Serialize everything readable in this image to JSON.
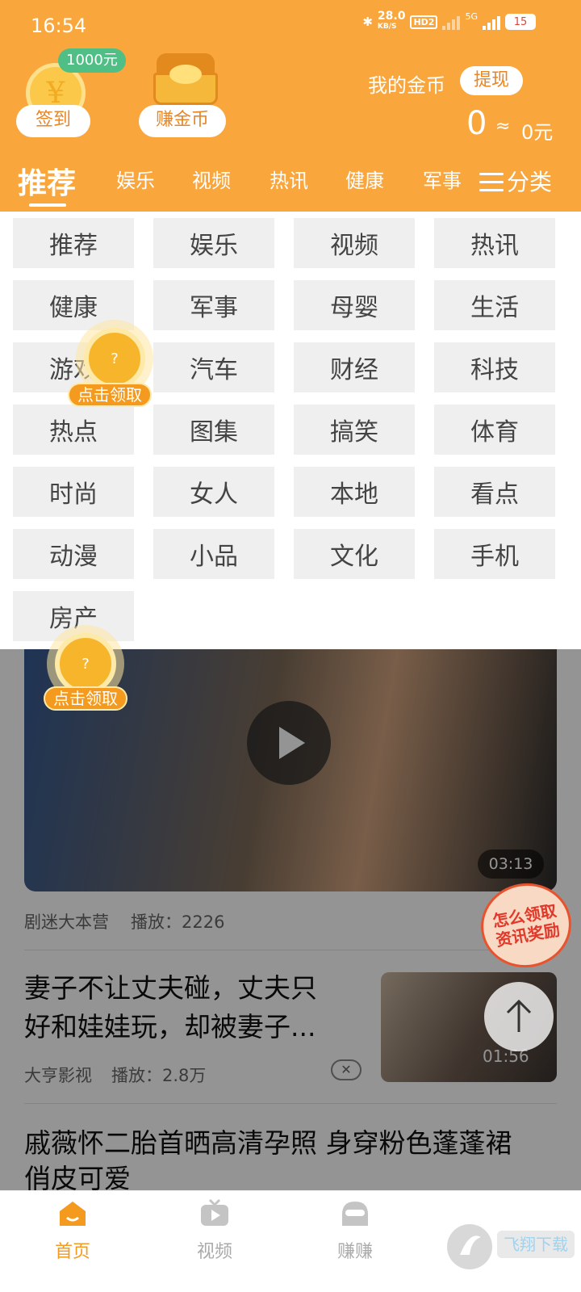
{
  "status_bar": {
    "time": "16:54",
    "network_speed": "28.0",
    "network_unit": "KB/S",
    "hd_badge": "HD2",
    "signal_label": "5G",
    "battery": "15"
  },
  "header": {
    "checkin_badge": "1000元",
    "checkin_label": "签到",
    "earn_coins_label": "赚金币",
    "my_coins_label": "我的金币",
    "withdraw_label": "提现",
    "coin_count": "0",
    "approx": "≈",
    "coin_value": "0元"
  },
  "tabs": [
    {
      "label": "推荐"
    },
    {
      "label": "娱乐"
    },
    {
      "label": "视频"
    },
    {
      "label": "热讯"
    },
    {
      "label": "健康"
    },
    {
      "label": "军事"
    }
  ],
  "category_label": "分类",
  "categories": [
    "推荐",
    "娱乐",
    "视频",
    "热讯",
    "健康",
    "军事",
    "母婴",
    "生活",
    "游戏",
    "汽车",
    "财经",
    "科技",
    "热点",
    "图集",
    "搞笑",
    "体育",
    "时尚",
    "女人",
    "本地",
    "看点",
    "动漫",
    "小品",
    "文化",
    "手机",
    "房产"
  ],
  "floating_coins": [
    {
      "symbol": "?",
      "label": "点击领取"
    },
    {
      "symbol": "?",
      "label": "点击领取"
    }
  ],
  "feed": {
    "video1": {
      "duration": "03:13",
      "source": "剧迷大本营",
      "plays": "播放：2226"
    },
    "article1": {
      "title_line1": "妻子不让丈夫碰，丈夫只",
      "title_line2": "好和娃娃玩，却被妻子...",
      "source": "大亨影视",
      "plays": "播放：2.8万",
      "duration": "01:56"
    },
    "article2": {
      "title_line1": "戚薇怀二胎首晒高清孕照 身穿粉色蓬蓬裙",
      "title_line2": "俏皮可爱"
    },
    "reward_badge_line1": "怎么领取",
    "reward_badge_line2": "资讯奖励"
  },
  "bottom_nav": [
    {
      "label": "首页",
      "icon": "home-icon",
      "active": true
    },
    {
      "label": "视频",
      "icon": "tv-icon",
      "active": false
    },
    {
      "label": "赚赚",
      "icon": "earn-icon",
      "active": false
    }
  ],
  "colors": {
    "brand_orange": "#f9a63d",
    "active_nav": "#f39a1f",
    "inactive_nav": "#bdbdbd"
  }
}
